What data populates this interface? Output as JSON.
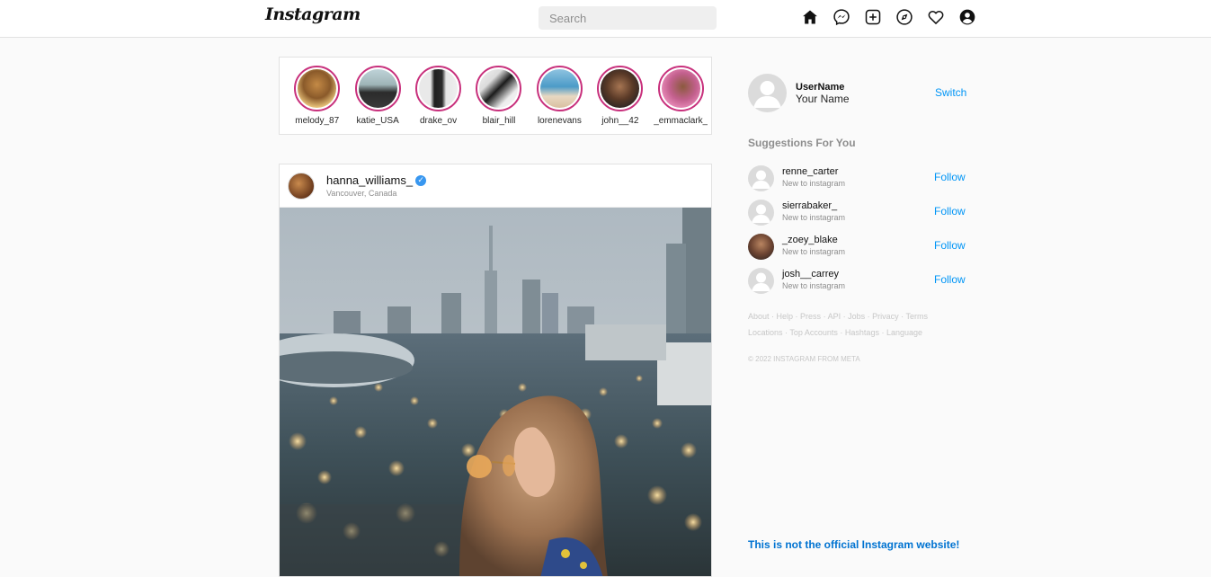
{
  "header": {
    "logo": "Instagram",
    "search_placeholder": "Search",
    "icons": [
      "home-icon",
      "messenger-icon",
      "new-post-icon",
      "explore-icon",
      "activity-heart-icon",
      "profile-icon"
    ]
  },
  "stories": [
    {
      "name": "melody_87"
    },
    {
      "name": "katie_USA"
    },
    {
      "name": "drake_ov"
    },
    {
      "name": "blair_hill"
    },
    {
      "name": "lorenevans"
    },
    {
      "name": "john__42"
    },
    {
      "name": "_emmaclark_"
    }
  ],
  "post": {
    "username": "hanna_williams_",
    "verified": true,
    "location": "Vancouver, Canada"
  },
  "sidebar": {
    "username": "UserName",
    "fullname": "Your Name",
    "switch_label": "Switch",
    "suggestions_title": "Suggestions For You",
    "suggestions": [
      {
        "user": "renne_carter",
        "sub": "New to instagram",
        "action": "Follow"
      },
      {
        "user": "sierrabaker_",
        "sub": "New to instagram",
        "action": "Follow"
      },
      {
        "user": "_zoey_blake",
        "sub": "New to instagram",
        "action": "Follow"
      },
      {
        "user": "josh__carrey",
        "sub": "New to instagram",
        "action": "Follow"
      }
    ],
    "footer_links_line1": [
      "About",
      "Help",
      "Press",
      "API",
      "Jobs",
      "Privacy",
      "Terms"
    ],
    "footer_links_line2": [
      "Locations",
      "Top Accounts",
      "Hashtags",
      "Language"
    ],
    "copyright": "© 2022 INSTAGRAM FROM META",
    "disclaimer": "This is not the official Instagram website!"
  },
  "colors": {
    "link": "#0095f6",
    "story_ring": "#c8307c",
    "background": "#fafafa"
  }
}
